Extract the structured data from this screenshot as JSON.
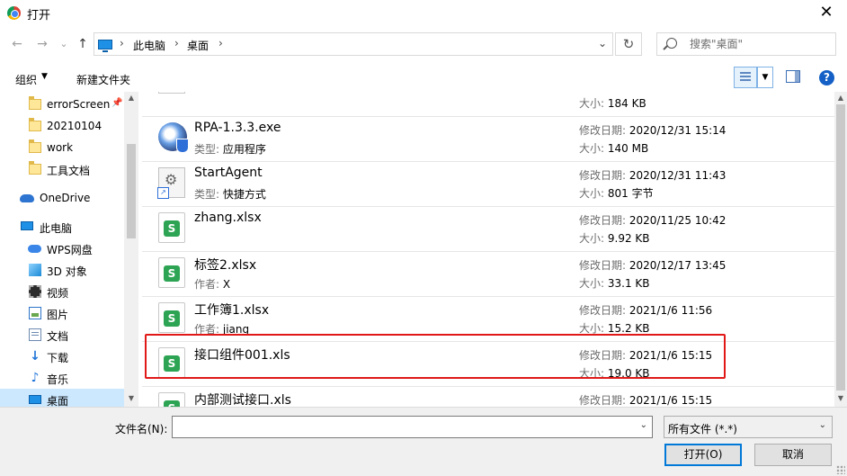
{
  "window": {
    "title": "打开",
    "close_glyph": "✕"
  },
  "nav": {
    "back_glyph": "←",
    "forward_glyph": "→",
    "recent_glyph": "⌄",
    "up_glyph": "↑",
    "breadcrumbs": [
      "此电脑",
      "桌面"
    ],
    "breadcrumb_sep": "›",
    "dropdown_glyph": "⌄",
    "refresh_glyph": "↻",
    "search_placeholder": "搜索\"桌面\""
  },
  "toolbar": {
    "organize": "组织",
    "organize_dd": "▼",
    "new_folder": "新建文件夹",
    "view_dd": "▼",
    "help": "?"
  },
  "sidebar": {
    "items": [
      {
        "label": "errorScreen",
        "icon": "folder-icon",
        "pinned": true
      },
      {
        "label": "20210104",
        "icon": "folder-icon"
      },
      {
        "label": "work",
        "icon": "folder-icon"
      },
      {
        "label": "工具文档",
        "icon": "folder-icon"
      },
      {
        "label": "OneDrive",
        "icon": "onedrive-icon"
      },
      {
        "label": "此电脑",
        "icon": "computer-icon"
      },
      {
        "label": "WPS网盘",
        "icon": "wps-cloud-icon"
      },
      {
        "label": "3D 对象",
        "icon": "3d-objects-icon"
      },
      {
        "label": "视频",
        "icon": "video-icon"
      },
      {
        "label": "图片",
        "icon": "pictures-icon"
      },
      {
        "label": "文档",
        "icon": "documents-icon"
      },
      {
        "label": "下载",
        "icon": "download-icon"
      },
      {
        "label": "音乐",
        "icon": "music-icon"
      },
      {
        "label": "桌面",
        "icon": "desktop-icon",
        "selected": true
      }
    ],
    "pin_glyph": "📌",
    "up_arrow": "▲",
    "down_arrow": "▼"
  },
  "files": {
    "partial_top": {
      "size_label": "大小:",
      "size": "184 KB"
    },
    "rows": [
      {
        "name": "RPA-1.3.3.exe",
        "sub_label": "类型:",
        "sub_value": "应用程序",
        "date_label": "修改日期:",
        "date": "2020/12/31 15:14",
        "size_label": "大小:",
        "size": "140 MB",
        "icon": "exe-icon"
      },
      {
        "name": "StartAgent",
        "sub_label": "类型:",
        "sub_value": "快捷方式",
        "date_label": "修改日期:",
        "date": "2020/12/31 11:43",
        "size_label": "大小:",
        "size": "801 字节",
        "icon": "shortcut-icon"
      },
      {
        "name": "zhang.xlsx",
        "sub_label": "",
        "sub_value": "",
        "date_label": "修改日期:",
        "date": "2020/11/25 10:42",
        "size_label": "大小:",
        "size": "9.92 KB",
        "icon": "spreadsheet-icon"
      },
      {
        "name": "标签2.xlsx",
        "sub_label": "作者:",
        "sub_value": "X",
        "date_label": "修改日期:",
        "date": "2020/12/17 13:45",
        "size_label": "大小:",
        "size": "33.1 KB",
        "icon": "spreadsheet-icon"
      },
      {
        "name": "工作簿1.xlsx",
        "sub_label": "作者:",
        "sub_value": "jiang",
        "date_label": "修改日期:",
        "date": "2021/1/6 11:56",
        "size_label": "大小:",
        "size": "15.2 KB",
        "icon": "spreadsheet-icon"
      },
      {
        "name": "接口组件001.xls",
        "sub_label": "",
        "sub_value": "",
        "date_label": "修改日期:",
        "date": "2021/1/6 15:15",
        "size_label": "大小:",
        "size": "19.0 KB",
        "icon": "spreadsheet-icon",
        "highlighted": true
      },
      {
        "name": "内部测试接口.xls",
        "sub_label": "",
        "sub_value": "",
        "date_label": "修改日期:",
        "date": "2021/1/6 15:15",
        "size_label": "",
        "size": "",
        "icon": "spreadsheet-icon"
      }
    ],
    "scroll_up": "▲",
    "scroll_down": "▼"
  },
  "footer": {
    "filename_label": "文件名(N):",
    "filename_value": "",
    "filename_dd": "⌄",
    "filetype": "所有文件 (*.*)",
    "filetype_dd": "⌄",
    "open_button": "打开(O)",
    "cancel_button": "取消"
  },
  "colors": {
    "accent": "#0078d7",
    "selection": "#cce8ff",
    "highlight_box": "#e11818",
    "spreadsheet": "#2ca453"
  }
}
